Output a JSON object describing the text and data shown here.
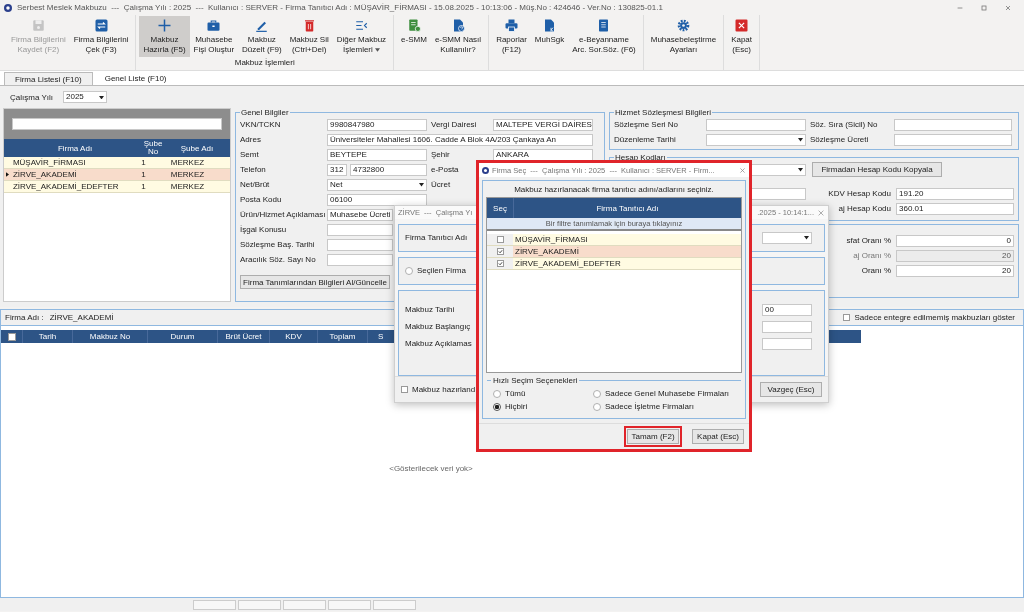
{
  "window": {
    "title": "Serbest Meslek Makbuzu  ---  Çalışma Yılı : 2025  ---  Kullanıcı : SERVER - Firma Tanıtıcı Adı : MÜŞAVİR_FİRMASI - 15.08.2025 - 10:13:06 - Müş.No : 424646 - Ver.No : 130825-01.1"
  },
  "toolbar": [
    {
      "buttons": [
        {
          "label": "Firma Bilgilerini\nKaydet (F2)",
          "selected": false,
          "disabled": true,
          "menu": false
        },
        {
          "label": "Firma Bilgilerini\nÇek (F3)",
          "selected": false,
          "disabled": false,
          "menu": false
        }
      ]
    },
    {
      "label": "Makbuz İşlemleri",
      "buttons": [
        {
          "label": "Makbuz\nHazırla (F5)",
          "selected": true,
          "disabled": false,
          "menu": false
        },
        {
          "label": "Muhasebe\nFişi Oluştur",
          "selected": false,
          "disabled": false,
          "menu": false
        },
        {
          "label": "Makbuz\nDüzelt (F9)",
          "selected": false,
          "disabled": false,
          "menu": false
        },
        {
          "label": "Makbuz Sil\n(Ctrl+Del)",
          "selected": false,
          "disabled": false,
          "menu": false
        },
        {
          "label": "Diğer Makbuz\nİşlemleri",
          "selected": false,
          "disabled": false,
          "menu": true
        }
      ]
    },
    {
      "buttons": [
        {
          "label": "e-SMM",
          "selected": false,
          "disabled": false,
          "menu": false
        },
        {
          "label": "e-SMM Nasıl\nKullanılır?",
          "selected": false,
          "disabled": false,
          "menu": false
        }
      ]
    },
    {
      "buttons": [
        {
          "label": "Raporlar\n(F12)",
          "selected": false,
          "disabled": false,
          "menu": false
        },
        {
          "label": "MuhSgk",
          "selected": false,
          "disabled": false,
          "menu": false
        },
        {
          "label": "e-Beyanname\nArc. Sor.Söz. (F6)",
          "selected": false,
          "disabled": false,
          "menu": false
        }
      ]
    },
    {
      "buttons": [
        {
          "label": "Muhasebeleştirme\nAyarları",
          "selected": false,
          "disabled": false,
          "menu": false
        }
      ]
    },
    {
      "buttons": [
        {
          "label": "Kapat\n(Esc)",
          "selected": false,
          "disabled": false,
          "menu": false
        }
      ]
    }
  ],
  "tabs": [
    {
      "label": "Firma Listesi (F10)",
      "selected": true
    },
    {
      "label": "Genel Liste (F10)",
      "selected": false
    }
  ],
  "year": {
    "label": "Çalışma Yılı",
    "value": "2025"
  },
  "firm_list": {
    "columns": [
      "Firma Adı",
      "Şube\nNo",
      "Şube Adı"
    ],
    "rows": [
      {
        "name": "MÜŞAVİR_FİRMASI",
        "branch_no": "1",
        "branch": "MERKEZ",
        "selected": false
      },
      {
        "name": "ZİRVE_AKADEMİ",
        "branch_no": "1",
        "branch": "MERKEZ",
        "selected": true
      },
      {
        "name": "ZİRVE_AKADEMİ_EDEFTER",
        "branch_no": "1",
        "branch": "MERKEZ",
        "selected": false
      }
    ]
  },
  "genel_bilgiler": {
    "title": "Genel Bilgiler",
    "rows": [
      {
        "label": "VKN/TCKN",
        "kind": "text",
        "value": "9980847980",
        "right": {
          "label": "Vergi Dairesi",
          "value": "MALTEPE VERGİ DAİRES"
        }
      },
      {
        "label": "Adres",
        "kind": "wide",
        "value": "Üniversiteler Mahallesi 1606. Cadde A Blok 4A/203 Çankaya An"
      },
      {
        "label": "Semt",
        "kind": "text",
        "value": "BEYTEPE",
        "right": {
          "label": "Şehir",
          "value": "ANKARA"
        }
      },
      {
        "label": "Telefon",
        "kind": "phone",
        "value": "312",
        "value2": "4732800",
        "right": {
          "label": "e-Posta"
        }
      },
      {
        "label": "Net/Brüt",
        "kind": "select",
        "value": "Net",
        "right": {
          "label": "Ücret"
        }
      },
      {
        "label": "Posta Kodu",
        "kind": "text",
        "value": "06100"
      },
      {
        "label": "Ürün/Hizmet Açıklaması",
        "kind": "short",
        "value": "Muhasebe Ücreti"
      },
      {
        "label": "İşgal Konusu",
        "kind": "short"
      },
      {
        "label": "Sözleşme Baş. Tarihi",
        "kind": "short"
      },
      {
        "label": "Aracılık Söz. Sayı No",
        "kind": "short"
      }
    ],
    "button": "Firma Tanımlarından Bilgileri Al/Güncelle"
  },
  "hizmet": {
    "title": "Hizmet Sözleşmesi Bilgileri",
    "rows": [
      {
        "label": "Sözleşme Seri No",
        "kind": "text",
        "right": {
          "label": "Söz. Sıra (Sicil) No"
        }
      },
      {
        "label": "Düzenleme Tarihi",
        "kind": "select",
        "right": {
          "label": "Sözleşme Ücreti"
        }
      }
    ]
  },
  "hesap": {
    "title": "Hesap Kodları",
    "copy_button": "Firmadan Hesap Kodu Kopyala",
    "rows": [
      {
        "kind": "select"
      },
      {
        "kind": "text",
        "right": {
          "label": "KDV Hesap Kodu",
          "value": "191.20"
        }
      },
      {
        "right": {
          "label": "aj Hesap Kodu",
          "value": "360.01"
        }
      }
    ]
  },
  "oranlar": {
    "rows": [
      {
        "right": {
          "label": "sfat Oranı %",
          "value": "0",
          "disabled": false
        }
      },
      {
        "right": {
          "label": "aj Oranı %",
          "value": "20",
          "disabled": true
        }
      },
      {
        "right": {
          "label": "Oranı %",
          "value": "20",
          "disabled": false
        }
      }
    ]
  },
  "bottom": {
    "firm_label": "Firma Adı :",
    "firm_name": "ZİRVE_AKADEMİ",
    "filter": {
      "label": "Sadece entegre edilmemiş makbuzları göster",
      "checked": false
    },
    "table": {
      "select_all": {
        "checked": false
      },
      "columns": [
        "Tarih",
        "Makbuz No",
        "Durum",
        "Brüt Ücret",
        "KDV",
        "Toplam",
        "S"
      ]
    },
    "empty_message": "<Gösterilecek veri yok>"
  },
  "back_dialog": {
    "title_left": "ZİRVE  ---  Çalışma Yı",
    "title_right": ".2025 - 10:14:1...",
    "firm_label": "Firma Tanıtıcı Adı",
    "radio": {
      "label": "Seçilen Firma",
      "selected": false
    },
    "fields": [
      {
        "label": "Makbuz Tarihi",
        "value": "00"
      },
      {
        "label": "Makbuz Başlangıç"
      },
      {
        "label": "Makbuz Açıklamas"
      }
    ],
    "footer_check": {
      "label": "Makbuz hazırland",
      "checked": false
    },
    "cancel_button": "Vazgeç (Esc)"
  },
  "dialog": {
    "title": "Firma Seç  ---  Çalışma Yılı : 2025  ---  Kullanıcı : SERVER - Firm...",
    "highlighted": true,
    "instruction": "Makbuz hazırlanacak firma tanıtıcı adını/adlarını seçiniz.",
    "columns": [
      "Seç",
      "Firma Tanıtıcı Adı"
    ],
    "filter_hint": "Bir filtre tanımlamak için buraya tıklayınız",
    "rows": [
      {
        "name": "MÜŞAVİR_FİRMASI",
        "checked": false,
        "selected": false
      },
      {
        "name": "ZİRVE_AKADEMİ",
        "checked": true,
        "selected": true
      },
      {
        "name": "ZİRVE_AKADEMİ_EDEFTER",
        "checked": true,
        "selected": false
      }
    ],
    "quick": {
      "title": "Hızlı Seçim Seçenekleri",
      "options": [
        {
          "label": "Tümü",
          "selected": false
        },
        {
          "label": "Sadece Genel Muhasebe Firmaları",
          "selected": false
        },
        {
          "label": "Hiçbiri",
          "selected": true
        },
        {
          "label": "Sadece İşletme Firmaları",
          "selected": false
        }
      ]
    },
    "buttons": [
      {
        "label": "Tamam (F2)",
        "highlighted": true
      },
      {
        "label": "Kapat (Esc)",
        "highlighted": false
      }
    ]
  }
}
